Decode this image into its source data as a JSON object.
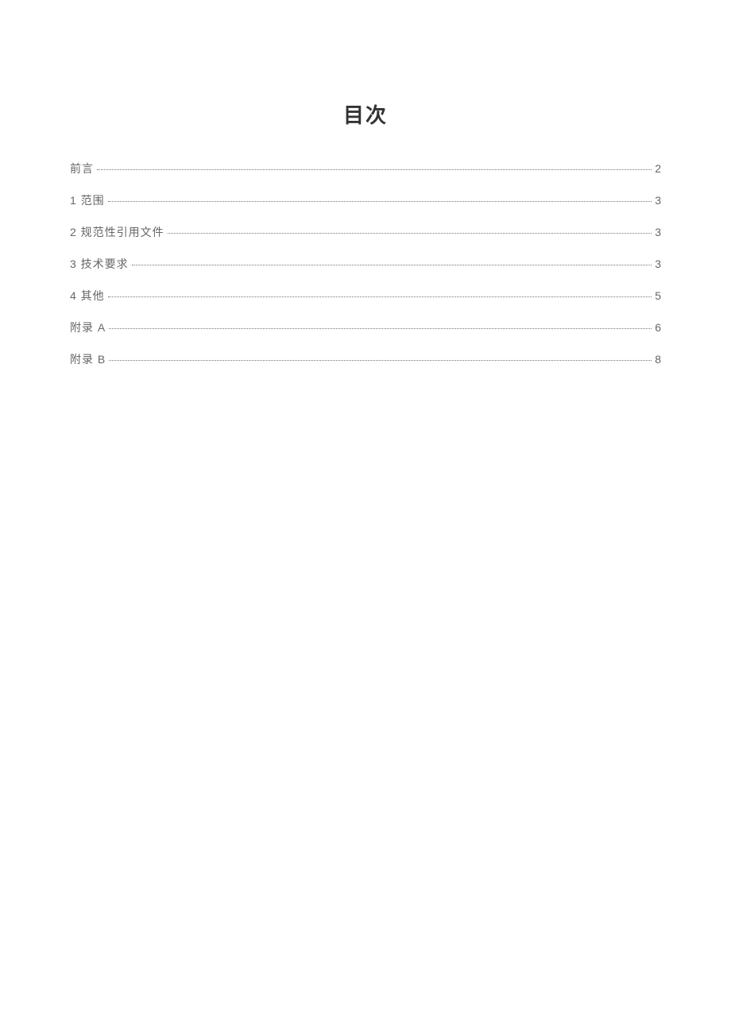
{
  "title": "目次",
  "toc": [
    {
      "label": "前言",
      "page": "2",
      "style": "wide"
    },
    {
      "label": "1 范围",
      "page": "3",
      "style": "wide"
    },
    {
      "label": "2 规范性引用文件",
      "page": "3",
      "style": "wide"
    },
    {
      "label": "3 技术要求",
      "page": "3",
      "style": "wide"
    },
    {
      "label": "4 其他",
      "page": "5",
      "style": "wide"
    },
    {
      "label": "附录 A",
      "page": "6",
      "style": "tight"
    },
    {
      "label": "附录 B",
      "page": "8",
      "style": "tight"
    }
  ]
}
